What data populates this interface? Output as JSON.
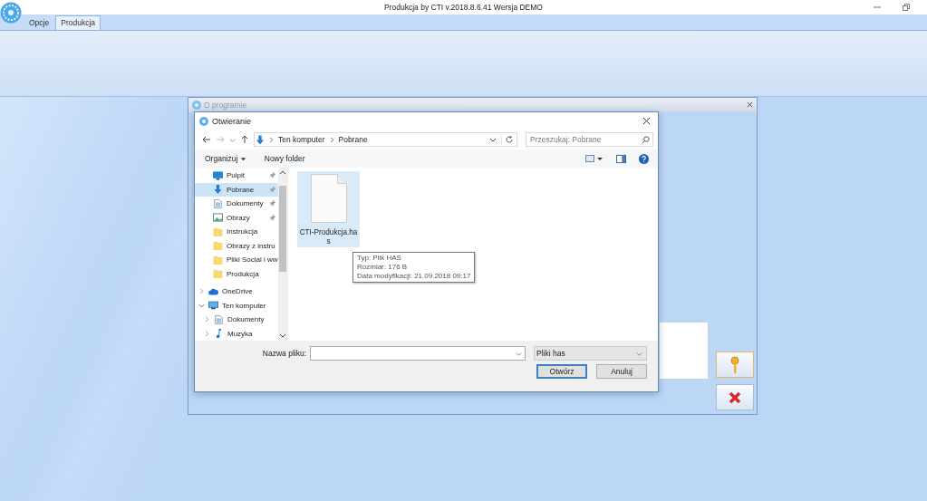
{
  "app": {
    "title": "Produkcja by CTI v.2018.8.6.41 Wersja DEMO"
  },
  "tabs": [
    {
      "label": "Opcje",
      "selected": false
    },
    {
      "label": "Produkcja",
      "selected": true
    }
  ],
  "about_dialog": {
    "title": "O programie"
  },
  "open_dialog": {
    "title": "Otwieranie",
    "path": [
      "Ten komputer",
      "Pobrane"
    ],
    "search": {
      "placeholder": "Przeszukaj: Pobrane"
    },
    "organize": "Organizuj",
    "new_folder": "Nowy folder",
    "quick_access": [
      {
        "label": "Pulpit",
        "kind": "desktop",
        "pinned": true,
        "selected": false
      },
      {
        "label": "Pobrane",
        "kind": "download",
        "pinned": true,
        "selected": true
      },
      {
        "label": "Dokumenty",
        "kind": "document",
        "pinned": true,
        "selected": false
      },
      {
        "label": "Obrazy",
        "kind": "pictures",
        "pinned": true,
        "selected": false
      },
      {
        "label": "Instrukcja",
        "kind": "folder",
        "pinned": false,
        "selected": false
      },
      {
        "label": "Obrazy z instru",
        "kind": "folder",
        "pinned": false,
        "selected": false
      },
      {
        "label": "Pliki Social i ww",
        "kind": "folder",
        "pinned": false,
        "selected": false
      },
      {
        "label": "Produkcja",
        "kind": "folder",
        "pinned": false,
        "selected": false
      }
    ],
    "tree": [
      {
        "label": "OneDrive",
        "kind": "cloud",
        "expanded": false
      },
      {
        "label": "Ten komputer",
        "kind": "computer",
        "expanded": true,
        "children": [
          {
            "label": "Dokumenty",
            "kind": "document",
            "expanded": false
          },
          {
            "label": "Muzyka",
            "kind": "music",
            "expanded": false
          }
        ]
      }
    ],
    "files": [
      {
        "name": "CTI-Produkcja.has",
        "selected": true
      }
    ],
    "tooltip": [
      "Typ: Plik HAS",
      "Rozmiar: 176 B",
      "Data modyfikacji: 21.09.2018 09:17"
    ],
    "filename_label": "Nazwa pliku:",
    "filter": "Pliki has",
    "buttons": [
      {
        "label": "Otwórz",
        "default": true
      },
      {
        "label": "Anuluj",
        "default": false
      }
    ]
  }
}
